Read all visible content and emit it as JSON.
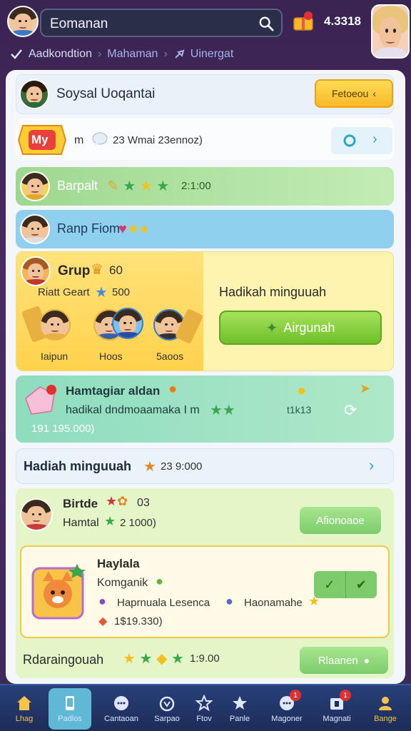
{
  "header": {
    "search_value": "Eomanan",
    "coins": "4.3318",
    "breadcrumb": [
      "Aadkondtion",
      "Mahaman",
      "Uinergat"
    ]
  },
  "profile_card": {
    "name": "Soysal Uoqantai",
    "button_label": "Fetoeou"
  },
  "my_row": {
    "badge": "My",
    "prefix": "m",
    "text": "23 Wmai 23ennoz)"
  },
  "rows": {
    "barpalt": {
      "name": "Barpalt",
      "value": "2:1:00"
    },
    "ranp": {
      "name": "Ranp Fiom"
    },
    "grup": {
      "title": "Grup",
      "count": "60",
      "subtitle": "Riatt Geart",
      "score": "500",
      "members": [
        "Iaipun",
        "Hoos",
        "5aoos"
      ],
      "reward_title": "Hadikah minguuah",
      "reward_button": "Airgunah"
    },
    "hamtagiar": {
      "title": "Hamtagiar aldan",
      "desc": "hadikal dndmoaamaka I m",
      "value": "t1k13",
      "amount": "191 195.000)"
    },
    "hadiah": {
      "title": "Hadiah minguuah",
      "value": "23 9:000"
    },
    "birtde": {
      "title": "Birtde",
      "extra": "03",
      "name": "Hamtal",
      "value": "2 1000)",
      "button": "Afionoaoe"
    },
    "haylala": {
      "title": "Haylala",
      "subtitle": "Komganik",
      "item1": "Haprnuala Lesenca",
      "item2": "Haonamahe",
      "price": "1$19.330)"
    },
    "rdarain": {
      "title": "Rdaraingouah",
      "value": "1:9.00",
      "button": "Rlaanen"
    }
  },
  "nav": [
    {
      "label": "Lhag",
      "icon": "home-icon"
    },
    {
      "label": "Padlos",
      "icon": "phone-icon"
    },
    {
      "label": "Cantaoan",
      "icon": "chat-icon"
    },
    {
      "label": "Sarpao",
      "icon": "bag-icon"
    },
    {
      "label": "Ftov",
      "icon": "star-outline-icon"
    },
    {
      "label": "Panle",
      "icon": "star-icon"
    },
    {
      "label": "Magoner",
      "icon": "message-icon",
      "badge": "1"
    },
    {
      "label": "Magnati",
      "icon": "mailbox-icon",
      "badge": "1"
    },
    {
      "label": "Bange",
      "icon": "user-icon"
    }
  ],
  "colors": {
    "background": "#3a2452",
    "panel": "#f3f6fb",
    "accent_green": "#6fbf2a",
    "accent_yellow": "#f7b928",
    "nav_bg": "#1d2c58"
  }
}
